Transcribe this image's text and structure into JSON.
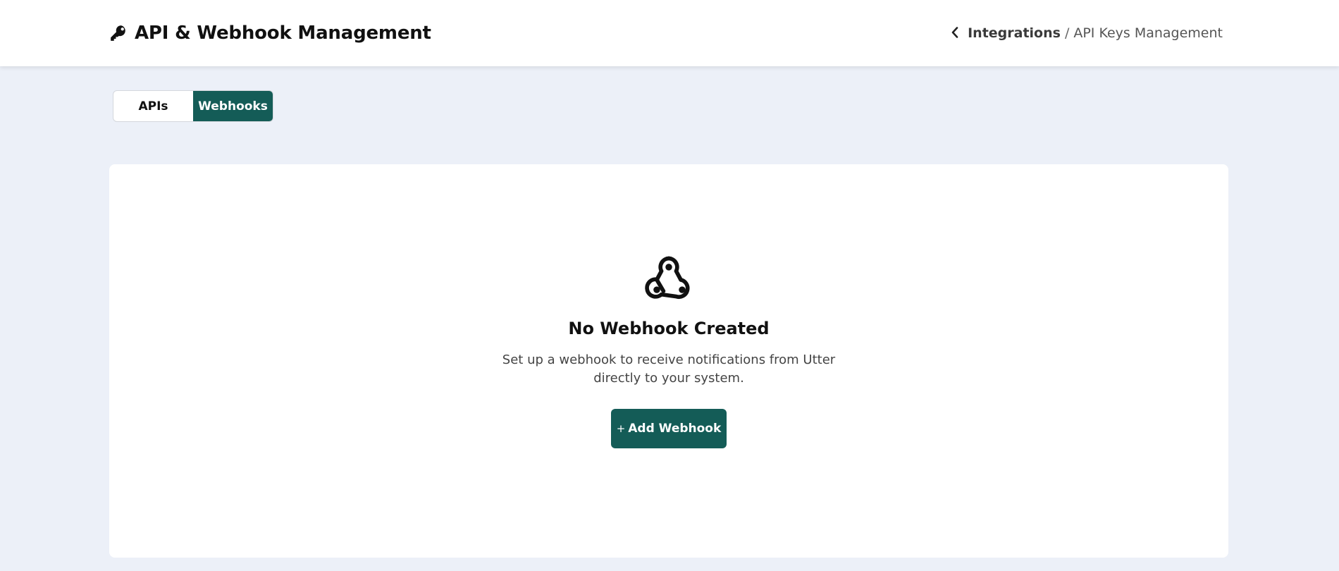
{
  "header": {
    "title": "API & Webhook Management",
    "title_icon": "key-icon",
    "breadcrumb": {
      "back_icon": "chevron-left-icon",
      "parent": "Integrations",
      "separator": "/",
      "current": "API Keys Management"
    }
  },
  "tabs": [
    {
      "label": "APIs",
      "active": false
    },
    {
      "label": "Webhooks",
      "active": true
    }
  ],
  "empty_state": {
    "icon": "webhook-icon",
    "title": "No Webhook Created",
    "description": "Set up a webhook to receive notifications from Utter directly to your system.",
    "button_icon": "+",
    "button_label": "Add Webhook"
  },
  "colors": {
    "accent": "#145c57",
    "background": "#ecf0f8",
    "card": "#ffffff"
  }
}
